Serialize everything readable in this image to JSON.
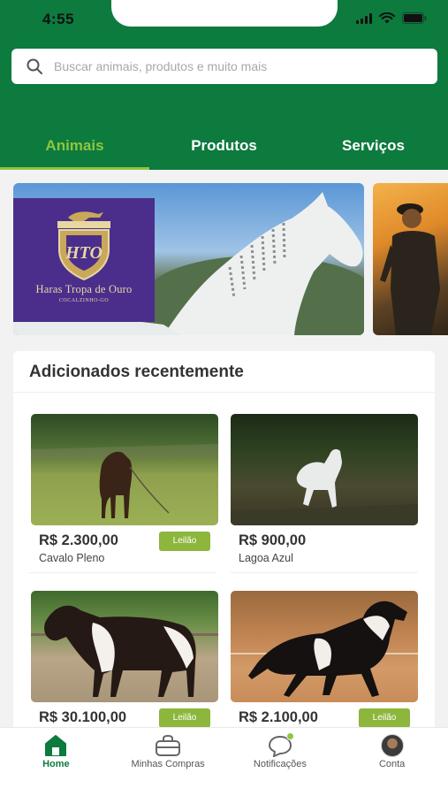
{
  "status_bar": {
    "time": "4:55"
  },
  "search": {
    "placeholder": "Buscar animais, produtos e muito mais"
  },
  "tabs": [
    {
      "label": "Animais",
      "active": true
    },
    {
      "label": "Produtos",
      "active": false
    },
    {
      "label": "Serviços",
      "active": false
    }
  ],
  "banners": [
    {
      "brand_initials": "HTO",
      "brand_name": "Haras Tropa de Ouro",
      "brand_city": "COCALZINHO-GO"
    },
    {
      "theme": "rider-sunset"
    }
  ],
  "recent": {
    "title": "Adicionados recentemente",
    "items": [
      {
        "price": "R$ 2.300,00",
        "name": "Cavalo Pleno",
        "badge": "Leilão"
      },
      {
        "price": "R$ 900,00",
        "name": "Lagoa Azul",
        "badge": ""
      },
      {
        "price": "R$ 30.100,00",
        "name": "",
        "badge": "Leilão"
      },
      {
        "price": "R$ 2.100,00",
        "name": "",
        "badge": "Leilão"
      }
    ]
  },
  "bottom_nav": [
    {
      "label": "Home",
      "icon": "home-icon",
      "active": true
    },
    {
      "label": "Minhas Compras",
      "icon": "bag-icon",
      "active": false
    },
    {
      "label": "Notificações",
      "icon": "chat-bubble-icon",
      "active": false
    },
    {
      "label": "Conta",
      "icon": "avatar",
      "active": false
    }
  ],
  "colors": {
    "primary_green": "#0d7a3e",
    "accent_lime": "#8dc63f",
    "badge_green": "#8db63c",
    "brand_purple": "#4b2e8c"
  }
}
